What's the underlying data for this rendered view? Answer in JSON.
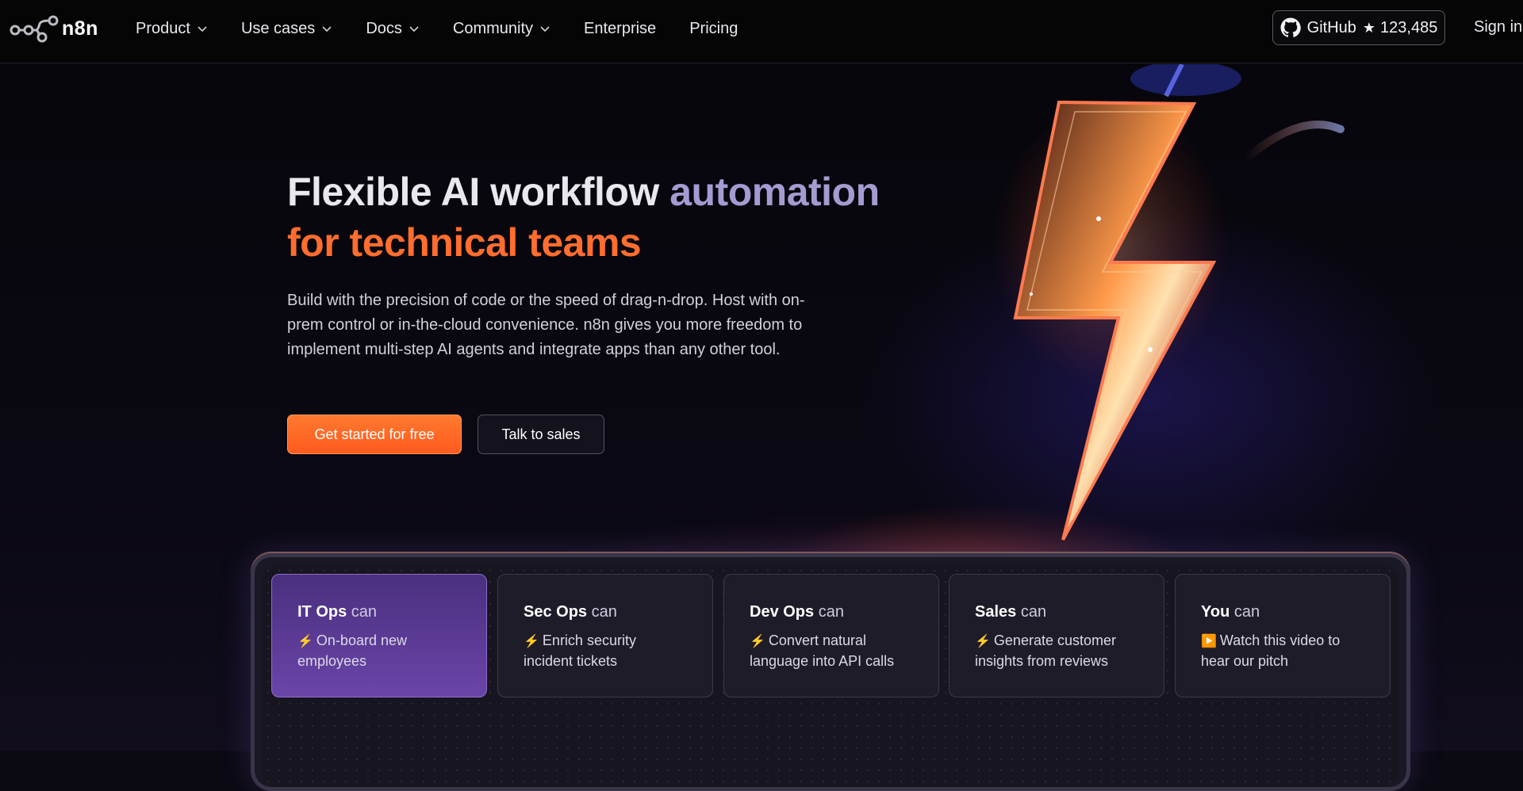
{
  "nav": {
    "logo_text": "n8n",
    "items": [
      {
        "label": "Product",
        "dropdown": true
      },
      {
        "label": "Use cases",
        "dropdown": true
      },
      {
        "label": "Docs",
        "dropdown": true
      },
      {
        "label": "Community",
        "dropdown": true
      },
      {
        "label": "Enterprise",
        "dropdown": false
      },
      {
        "label": "Pricing",
        "dropdown": false
      }
    ],
    "github": {
      "label": "GitHub",
      "star": "★",
      "count": "123,485"
    },
    "signin": "Sign in"
  },
  "hero": {
    "headline_part1": "Flexible AI workflow",
    "headline_part2": "automation",
    "headline_part3": "for technical teams",
    "description": "Build with the precision of code or the speed of drag-n-drop. Host with on-prem control or in-the-cloud convenience. n8n gives you more freedom to implement multi-step AI agents and integrate apps than any other tool.",
    "cta_primary": "Get started for free",
    "cta_secondary": "Talk to sales"
  },
  "cards": [
    {
      "role": "IT Ops",
      "suffix": "can",
      "icon": "⚡",
      "task": "On-board new employees",
      "active": true
    },
    {
      "role": "Sec Ops",
      "suffix": "can",
      "icon": "⚡",
      "task": "Enrich security incident tickets",
      "active": false
    },
    {
      "role": "Dev Ops",
      "suffix": "can",
      "icon": "⚡",
      "task": "Convert natural language into API calls",
      "active": false
    },
    {
      "role": "Sales",
      "suffix": "can",
      "icon": "⚡",
      "task": "Generate customer insights from reviews",
      "active": false
    },
    {
      "role": "You",
      "suffix": "can",
      "icon": "▶️",
      "task": "Watch this video to hear our pitch",
      "active": false
    }
  ],
  "colors": {
    "accent_orange": "#ff6d2f",
    "accent_purple": "#a59bd1",
    "active_card": "#6a45a8"
  }
}
